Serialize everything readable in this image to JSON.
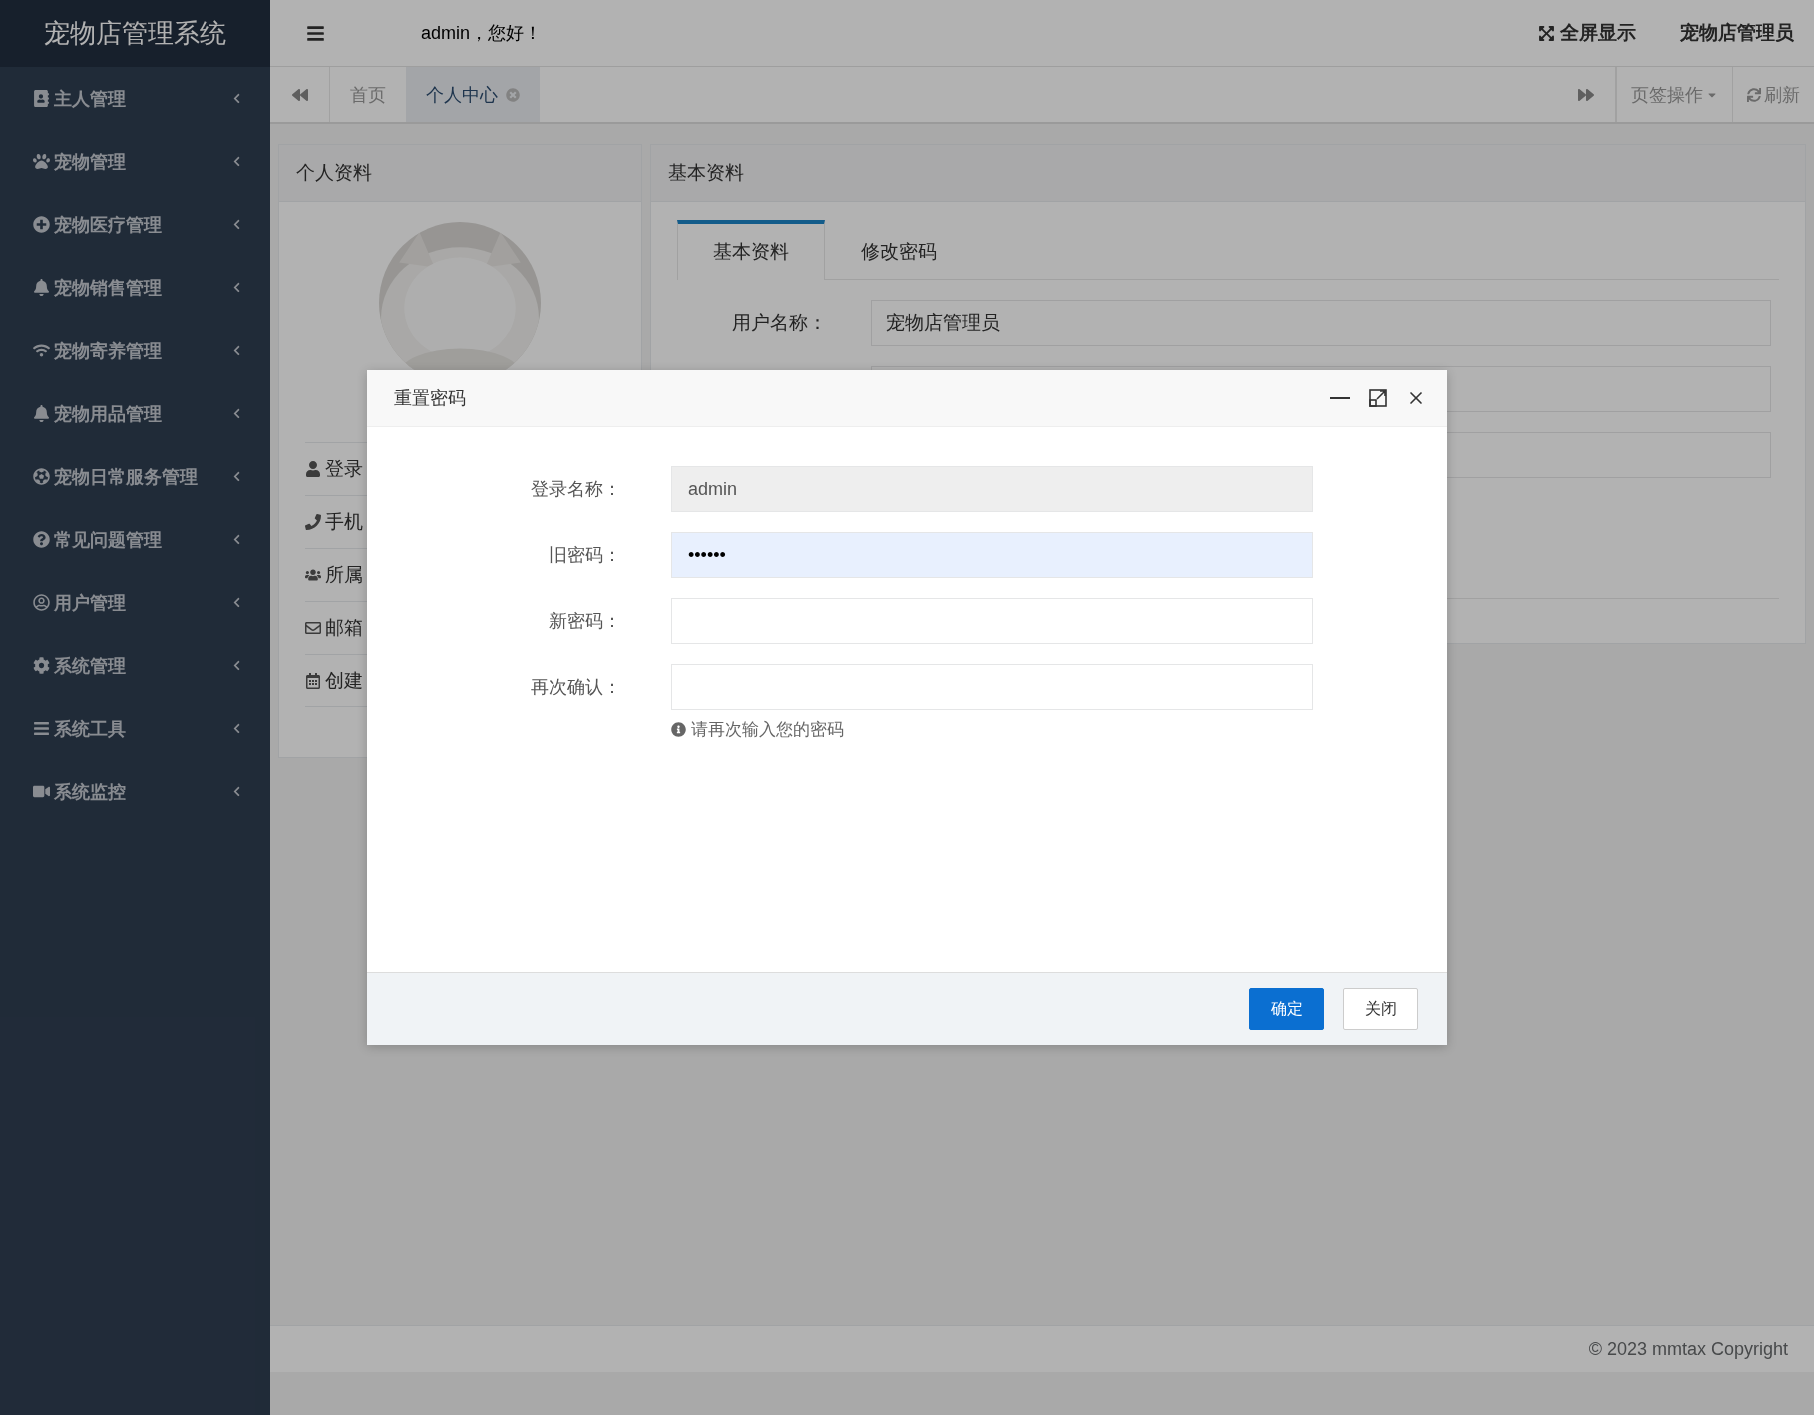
{
  "app_title": "宠物店管理系统",
  "sidebar": {
    "items": [
      {
        "label": "主人管理"
      },
      {
        "label": "宠物管理"
      },
      {
        "label": "宠物医疗管理"
      },
      {
        "label": "宠物销售管理"
      },
      {
        "label": "宠物寄养管理"
      },
      {
        "label": "宠物用品管理"
      },
      {
        "label": "宠物日常服务管理"
      },
      {
        "label": "常见问题管理"
      },
      {
        "label": "用户管理"
      },
      {
        "label": "系统管理"
      },
      {
        "label": "系统工具"
      },
      {
        "label": "系统监控"
      }
    ]
  },
  "topbar": {
    "greeting": "admin，您好！",
    "fullscreen": "全屏显示",
    "user": "宠物店管理员"
  },
  "page_tabs": [
    {
      "label": "首页",
      "selected": false,
      "closable": false
    },
    {
      "label": "个人中心",
      "selected": true,
      "closable": true
    }
  ],
  "tab_actions": {
    "menu": "页签操作",
    "refresh": "刷新"
  },
  "profile_panel": {
    "title": "个人资料",
    "fields": [
      "登录",
      "手机",
      "所属",
      "邮箱",
      "创建"
    ]
  },
  "info_panel": {
    "title": "基本资料",
    "tabs": [
      {
        "label": "基本资料",
        "selected": true
      },
      {
        "label": "修改密码",
        "selected": false
      }
    ],
    "fields": [
      {
        "kind": "text",
        "label": "用户名称：",
        "value": "宠物店管理员"
      },
      {
        "kind": "covered"
      },
      {
        "kind": "covered"
      }
    ]
  },
  "dialog": {
    "title": "重置密码",
    "fields": [
      {
        "label": "登录名称：",
        "value": "admin",
        "disabled": true,
        "focused": false
      },
      {
        "label": "旧密码：",
        "value": "••••••",
        "disabled": false,
        "focused": true
      },
      {
        "label": "新密码：",
        "disabled": false,
        "focused": false
      },
      {
        "label": "再次确认：",
        "disabled": false,
        "focused": false
      }
    ],
    "hint": "请再次输入您的密码",
    "buttons": [
      {
        "label": "确定",
        "kind": "primary"
      },
      {
        "label": "关闭",
        "kind": "default"
      }
    ]
  },
  "footer": "© 2023 mmtax Copyright"
}
